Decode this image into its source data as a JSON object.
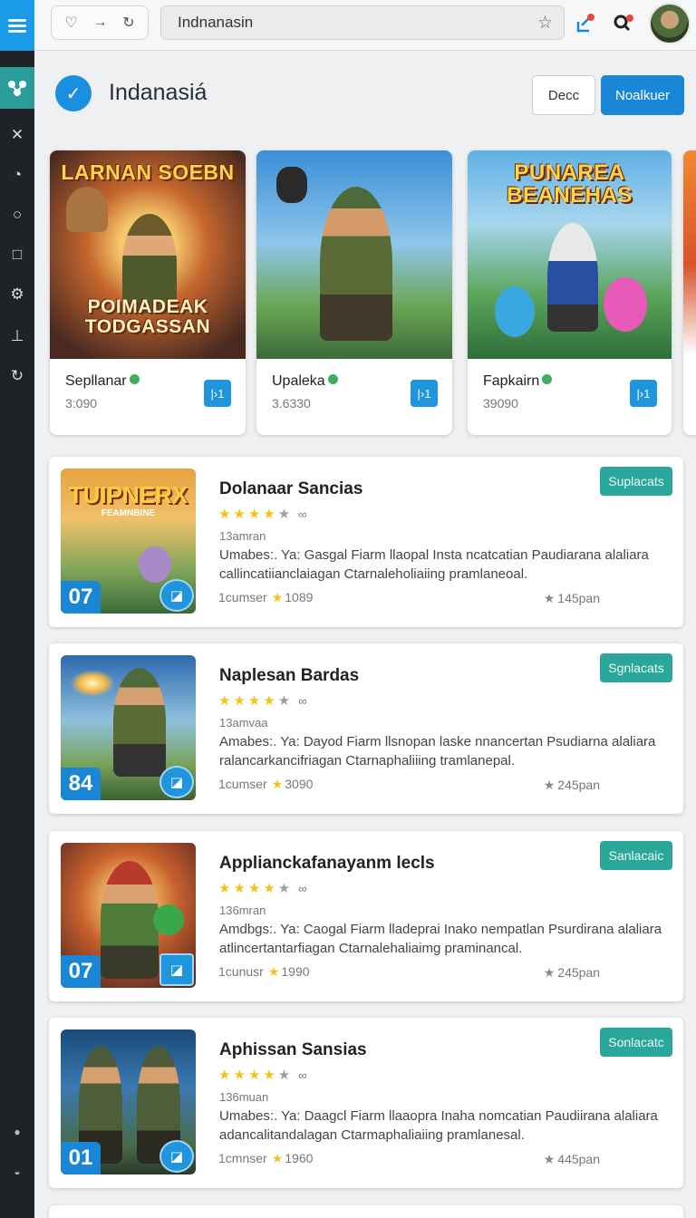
{
  "browser": {
    "url": "Indnanasin"
  },
  "header": {
    "title": "Indanasiá",
    "secondary_button": "Decc",
    "primary_button": "Noalkuer"
  },
  "featured": [
    {
      "art_title": "LARNAN SOEBN",
      "art_subtitle": "POIMADEAK TODGASSAN",
      "name": "Sepllanar",
      "count": "3:090",
      "action": "|›1"
    },
    {
      "art_title": "",
      "art_subtitle": "",
      "name": "Upaleka",
      "count": "3.6330",
      "action": "|›1"
    },
    {
      "art_title": "PUNAREA BEANEHAS",
      "art_subtitle": "",
      "name": "Fapkairn",
      "count": "39090",
      "action": "|›1"
    }
  ],
  "list": [
    {
      "rank": "07",
      "art_title": "TUIPNERX",
      "art_subtitle": "FEAMNBINE",
      "title": "Dolanaar Sancias",
      "sub": "13amran",
      "desc": "Umabes:. Ya: Gasgal Fiarm llaopal Insta ncatcatian Paudiarana alaliara callincatiianclaiagan Ctarnaleholiaiing pramlaneoal.",
      "meta_label": "1cumser",
      "meta_value": "1089",
      "rating_count": "145pan",
      "tag": "Suplacats"
    },
    {
      "rank": "84",
      "art_title": "",
      "art_subtitle": "",
      "title": "Naplesan Bardas",
      "sub": "13amvaa",
      "desc": "Amabes:. Ya: Dayod Fiarm llsnopan laske nnancertan Psudiarna alaliara ralancarkancifriagan Ctarnaphaliiing tramlanepal.",
      "meta_label": "1cumser",
      "meta_value": "3090",
      "rating_count": "245pan",
      "tag": "Sgnlacats"
    },
    {
      "rank": "07",
      "art_title": "",
      "art_subtitle": "",
      "title": "Applianckafanayanm lecls",
      "sub": "136mran",
      "desc": "Amdbgs:. Ya: Caogal Fiarm lladeprai Inako nempatlan Psurdirana alaliara atlincertantarfiagan Ctarnalehaliaimg praminancal.",
      "meta_label": "1cunusr",
      "meta_value": "1990",
      "rating_count": "245pan",
      "tag": "Sanlacaic"
    },
    {
      "rank": "01",
      "art_title": "",
      "art_subtitle": "",
      "title": "Aphissan Sansias",
      "sub": "136muan",
      "desc": "Umabes:. Ya: Daagcl Fiarm llaaopra Inaha nomcatian Paudiirana alaliara adancalitandalagan Ctarmaphaliaiing pramlanesal.",
      "meta_label": "1cmnser",
      "meta_value": "1960",
      "rating_count": "445pan",
      "tag": "Sonlacatc"
    }
  ],
  "icons": {
    "rail": [
      "menu-icon",
      "share-nodes-icon",
      "close-icon",
      "dial-icon",
      "circle-icon",
      "square-icon",
      "puzzle-icon",
      "bar-icon",
      "refresh-icon",
      "dot-icon",
      "power-icon"
    ],
    "toolbar": [
      "heart-icon",
      "forward-icon",
      "reload-icon",
      "star-icon",
      "share-icon",
      "search-notification-icon"
    ]
  },
  "colors": {
    "accent": "#1a86d6",
    "teal": "#2aa79a",
    "rail": "#1f2328",
    "star": "#f4c21a"
  }
}
